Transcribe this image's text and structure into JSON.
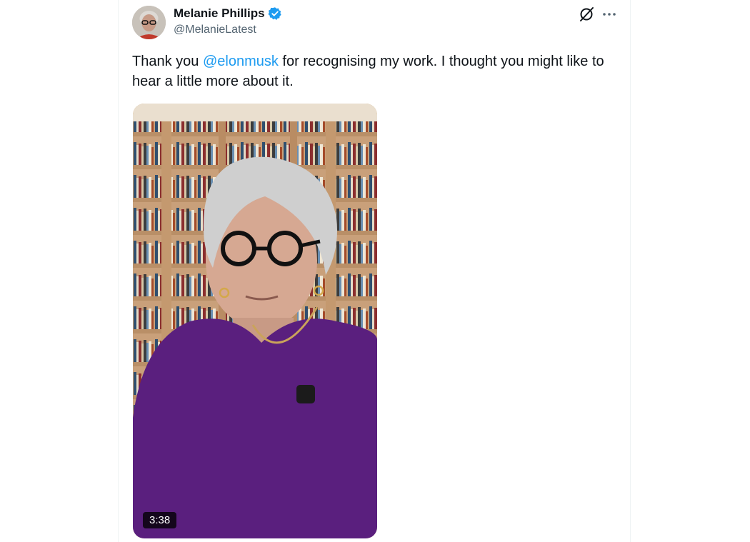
{
  "tweet": {
    "author": {
      "display_name": "Melanie Phillips",
      "handle": "@MelanieLatest",
      "verified": true
    },
    "text_prefix": "Thank you ",
    "mention": "@elonmusk",
    "text_suffix": " for recognising my work. I thought you might like to hear a little more about it.",
    "media": {
      "type": "video",
      "duration": "3:38"
    }
  },
  "colors": {
    "accent": "#1d9bf0",
    "text": "#0f1419",
    "secondary_text": "#536471"
  },
  "icons": [
    "verified-badge-icon",
    "grok-icon",
    "more-options-icon"
  ]
}
